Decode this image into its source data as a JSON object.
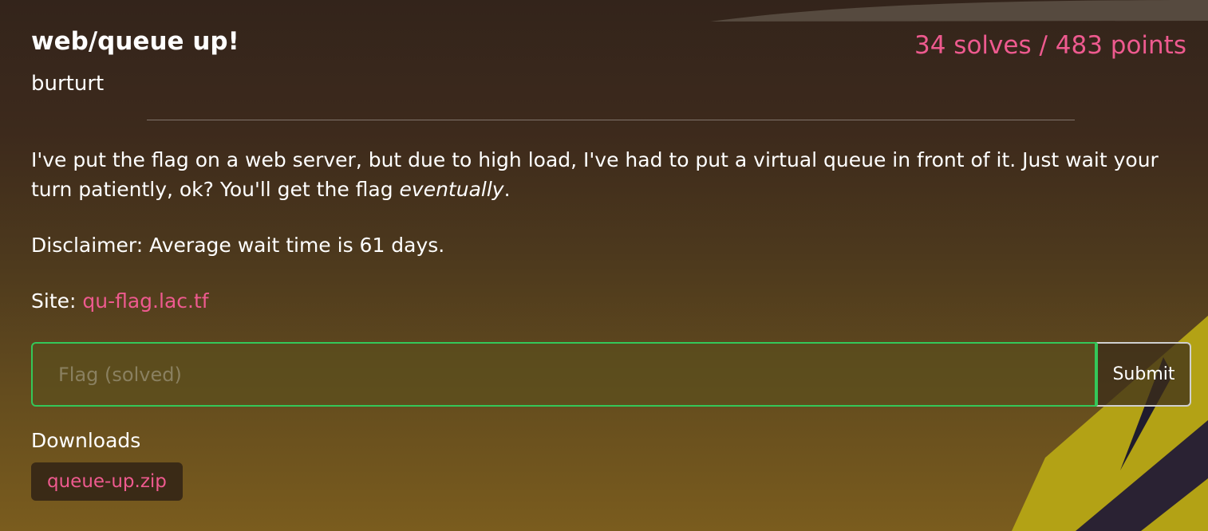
{
  "challenge": {
    "title": "web/queue up!",
    "author": "burturt",
    "stats": "34 solves / 483 points",
    "description_main": "I've put the flag on a web server, but due to high load, I've had to put a virtual queue in front of it. Just wait your turn patiently, ok? You'll get the flag ",
    "description_emphasis": "eventually",
    "description_end": ".",
    "disclaimer": "Disclaimer: Average wait time is 61 days.",
    "site_label": "Site: ",
    "site_link": "qu-flag.lac.tf"
  },
  "flag_form": {
    "placeholder": "Flag (solved)",
    "value": "",
    "submit_label": "Submit"
  },
  "downloads": {
    "label": "Downloads",
    "files": [
      {
        "name": "queue-up.zip"
      }
    ]
  },
  "colors": {
    "accent": "#ee5a8f",
    "solved_border": "#34c759",
    "decor_yellow": "#b3a215",
    "decor_dark": "#2a2233"
  },
  "icons": {
    "background": "decorative-shapes"
  }
}
